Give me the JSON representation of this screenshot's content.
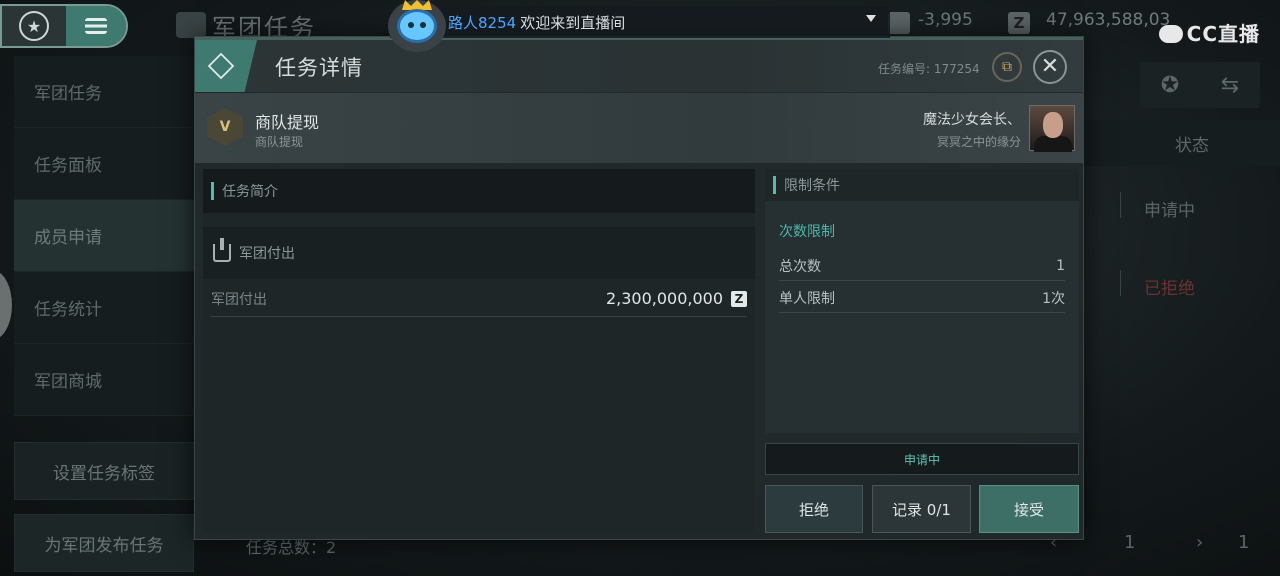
{
  "background": {
    "title": "军团任务",
    "resources": {
      "value1": "-3,995",
      "value2": "47,963,588,03"
    },
    "nav": [
      "军团任务",
      "任务面板",
      "成员申请",
      "任务统计",
      "军团商城"
    ],
    "buttons": {
      "set_tag": "设置任务标签",
      "publish": "为军团发布任务"
    },
    "table": {
      "header_status": "状态",
      "rows": [
        {
          "status": "申请中",
          "color": "#5a6465"
        },
        {
          "status": "已拒绝",
          "color": "#6e3030"
        }
      ]
    },
    "task_total": "任务总数：2",
    "pager": {
      "current": "1",
      "total": "1",
      "prev": "‹",
      "next": "›"
    }
  },
  "stream": {
    "logo": "CC直播",
    "username": "路人8254",
    "message": "欢迎来到直播间"
  },
  "dialog": {
    "title": "任务详情",
    "task_number": "任务编号: 177254",
    "close_symbol": "✕",
    "ext_symbol": "⧉",
    "task": {
      "badge": "V",
      "title": "商队提现",
      "subtitle": "商队提现",
      "owner_name": "魔法少女会长、",
      "owner_tag": "冥冥之中的缘分"
    },
    "left_panel": {
      "header": "任务简介",
      "section": "军团付出",
      "row_label": "军团付出",
      "row_value": "2,300,000,000",
      "currency_symbol": "Z"
    },
    "right_panel": {
      "header": "限制条件",
      "group": "次数限制",
      "rows": [
        {
          "label": "总次数",
          "value": "1"
        },
        {
          "label": "单人限制",
          "value": "1次"
        }
      ]
    },
    "status": "申请中",
    "buttons": {
      "reject": "拒绝",
      "record": "记录 0/1",
      "accept": "接受"
    }
  },
  "colors": {
    "accent": "#5bb9ad",
    "accept_button": "#3e6f67",
    "stream_user": "#4aa8ff"
  }
}
